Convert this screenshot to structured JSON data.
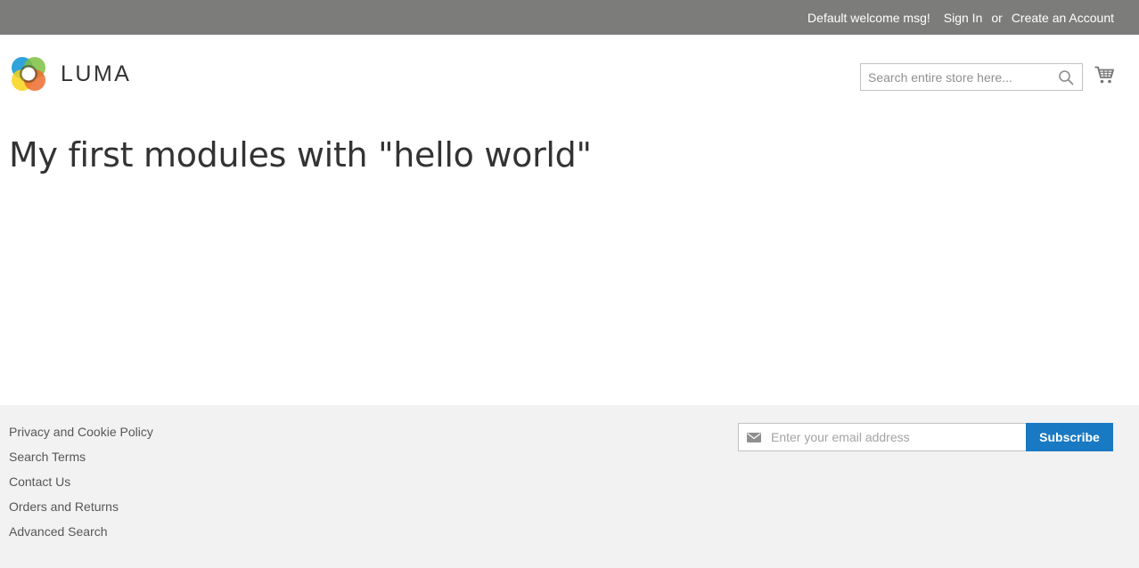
{
  "topbar": {
    "welcome": "Default welcome msg!",
    "sign_in": "Sign In",
    "or": "or",
    "create_account": "Create an Account",
    "background": "#7c7d7b"
  },
  "header": {
    "logo_text": "LUMA",
    "search": {
      "placeholder": "Search entire store here...",
      "value": "",
      "icon": "search-icon"
    },
    "cart_icon": "cart-icon"
  },
  "main": {
    "title": "My first modules with \"hello world\""
  },
  "footer": {
    "links": [
      {
        "label": "Privacy and Cookie Policy"
      },
      {
        "label": "Search Terms"
      },
      {
        "label": "Contact Us"
      },
      {
        "label": "Orders and Returns"
      },
      {
        "label": "Advanced Search"
      }
    ],
    "newsletter": {
      "placeholder": "Enter your email address",
      "value": "",
      "icon": "envelope-icon",
      "button": "Subscribe"
    },
    "background": "#f2f2f2"
  },
  "colors": {
    "accent": "#1979c3",
    "text": "#333333",
    "link": "#575757"
  }
}
